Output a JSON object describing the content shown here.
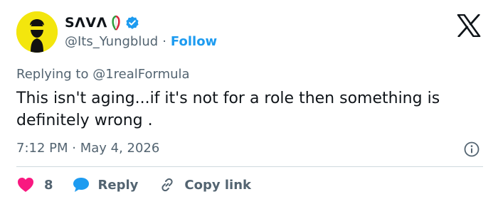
{
  "user": {
    "display_name": "SΛVΛ",
    "handle": "@Its_Yungblud",
    "separator": "·",
    "follow_label": "Follow"
  },
  "tweet": {
    "reply_to": "Replying to @1realFormula",
    "text": "This isn't aging...if it's not for a role then something is definitely wrong .",
    "timestamp": "7:12 PM · May 4, 2026"
  },
  "actions": {
    "like_count": "8",
    "reply_label": "Reply",
    "copy_label": "Copy link"
  },
  "icons": {
    "logo": "x-logo-icon",
    "verified": "verified-badge-icon",
    "flag": "italian-flag-emoji-icon",
    "info": "info-icon",
    "like": "heart-icon",
    "reply": "speech-bubble-icon",
    "copy": "link-icon"
  },
  "colors": {
    "accent": "#1d9bf0",
    "like": "#f91880",
    "text": "#0f1419",
    "muted": "#536471",
    "divider": "#cfd9de"
  }
}
